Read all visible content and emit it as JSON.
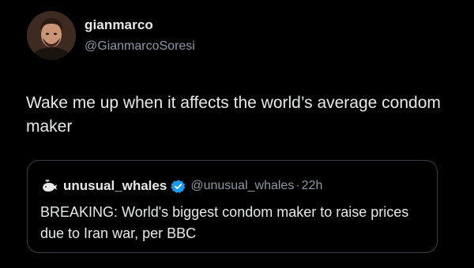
{
  "author": {
    "name": "gianmarco",
    "handle": "@GianmarcoSoresi",
    "avatar_icon": "profile-photo"
  },
  "tweet": {
    "text": "Wake me up when it affects the world’s average condom maker"
  },
  "quoted_tweet": {
    "name": "unusual_whales",
    "handle": "@unusual_whales",
    "separator": "·",
    "time": "22h",
    "verified_icon": "verified-badge-icon",
    "avatar_icon": "whale-icon",
    "text": "BREAKING: World's biggest condom maker to raise prices due to Iran war, per BBC"
  },
  "colors": {
    "background": "#000000",
    "text": "#e7e9ea",
    "secondary_text": "#8b98a5",
    "verified": "#1d9bf0",
    "border": "#3a3f44"
  }
}
